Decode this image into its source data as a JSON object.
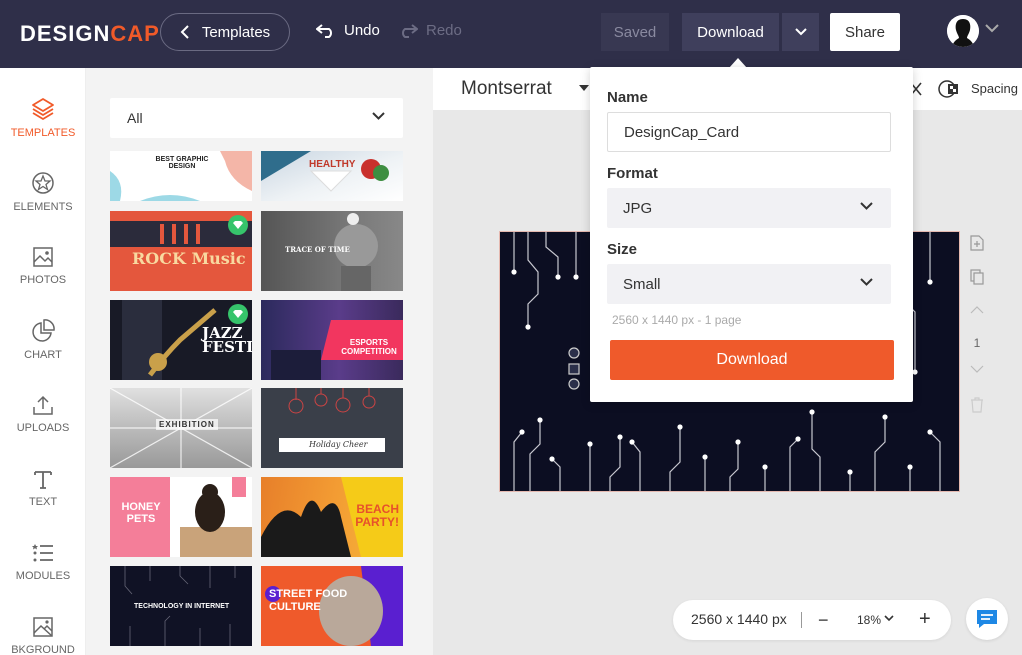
{
  "header": {
    "logo_main": "DESIGN",
    "logo_accent": "CAP",
    "templates_label": "Templates",
    "undo_label": "Undo",
    "redo_label": "Redo",
    "saved_label": "Saved",
    "download_label": "Download",
    "share_label": "Share"
  },
  "sidebar": {
    "items": [
      {
        "label": "TEMPLATES",
        "icon": "layers-icon",
        "active": true
      },
      {
        "label": "ELEMENTS",
        "icon": "shapes-icon",
        "active": false
      },
      {
        "label": "PHOTOS",
        "icon": "image-icon",
        "active": false
      },
      {
        "label": "CHART",
        "icon": "pie-chart-icon",
        "active": false
      },
      {
        "label": "UPLOADS",
        "icon": "upload-icon",
        "active": false
      },
      {
        "label": "TEXT",
        "icon": "text-icon",
        "active": false
      },
      {
        "label": "MODULES",
        "icon": "list-icon",
        "active": false
      },
      {
        "label": "BKGROUND",
        "icon": "background-icon",
        "active": false
      }
    ]
  },
  "templates_panel": {
    "filter_value": "All",
    "thumbnails": [
      {
        "title": "BEST GRAPHIC DESIGN",
        "premium": false
      },
      {
        "title": "HEALTHY",
        "premium": false
      },
      {
        "title": "ROCK Music",
        "premium": true
      },
      {
        "title": "TRACE OF TIME",
        "premium": false
      },
      {
        "title": "JAZZ FESTIVAL",
        "premium": true
      },
      {
        "title": "ESPORTS COMPETITION",
        "premium": false
      },
      {
        "title": "EXHIBITION",
        "premium": false
      },
      {
        "title": "Holiday Cheer",
        "premium": false
      },
      {
        "title": "HONEY PETS",
        "premium": false
      },
      {
        "title": "BEACH PARTY!",
        "premium": false
      },
      {
        "title": "TECHNOLOGY IN INTERNET",
        "premium": false
      },
      {
        "title": "STREET FOOD CULTURE",
        "premium": false
      }
    ]
  },
  "toolbar": {
    "font_name": "Montserrat",
    "spacing_label": "Spacing"
  },
  "page_controls": {
    "page_number": "1"
  },
  "zoom_bar": {
    "canvas_size": "2560 x 1440 px",
    "minus_label": "−",
    "zoom_value": "18%",
    "plus_label": "+"
  },
  "download_dropdown": {
    "name_label": "Name",
    "name_value": "DesignCap_Card",
    "format_label": "Format",
    "format_value": "JPG",
    "size_label": "Size",
    "size_value": "Small",
    "info_text": "2560 x 1440 px - 1 page",
    "download_button": "Download"
  },
  "colors": {
    "header_bg": "#2f2f49",
    "accent": "#f15a29",
    "download_button": "#ef5a2b",
    "canvas_bg": "#0c0e22",
    "premium_badge": "#36c46b"
  }
}
